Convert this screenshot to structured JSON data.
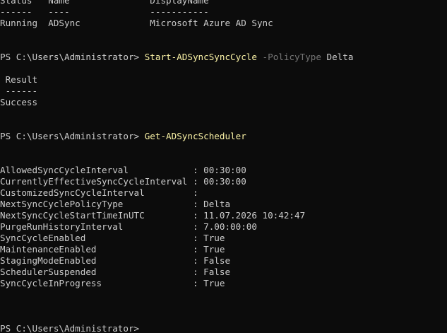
{
  "service_table": {
    "header": "Status   Name               DisplayName",
    "separator": "------   ----               -----------",
    "row": "Running  ADSync             Microsoft Azure AD Sync"
  },
  "prompt": "PS C:\\Users\\Administrator> ",
  "command1": {
    "cmdlet": "Start-ADSyncSyncCycle",
    "parameter": " -PolicyType",
    "argument": " Delta"
  },
  "result_table": {
    "header": " Result",
    "separator": " ------",
    "value": "Success"
  },
  "command2": {
    "cmdlet": "Get-ADSyncScheduler"
  },
  "scheduler": [
    "AllowedSyncCycleInterval            : 00:30:00",
    "CurrentlyEffectiveSyncCycleInterval : 00:30:00",
    "CustomizedSyncCycleInterval         :",
    "NextSyncCyclePolicyType             : Delta",
    "NextSyncCycleStartTimeInUTC         : 11.07.2026 10:42:47",
    "PurgeRunHistoryInterval             : 7.00:00:00",
    "SyncCycleEnabled                    : True",
    "MaintenanceEnabled                  : True",
    "StagingModeEnabled                  : False",
    "SchedulerSuspended                  : False",
    "SyncCycleInProgress                 : True"
  ],
  "final_prompt": "PS C:\\Users\\Administrator>"
}
